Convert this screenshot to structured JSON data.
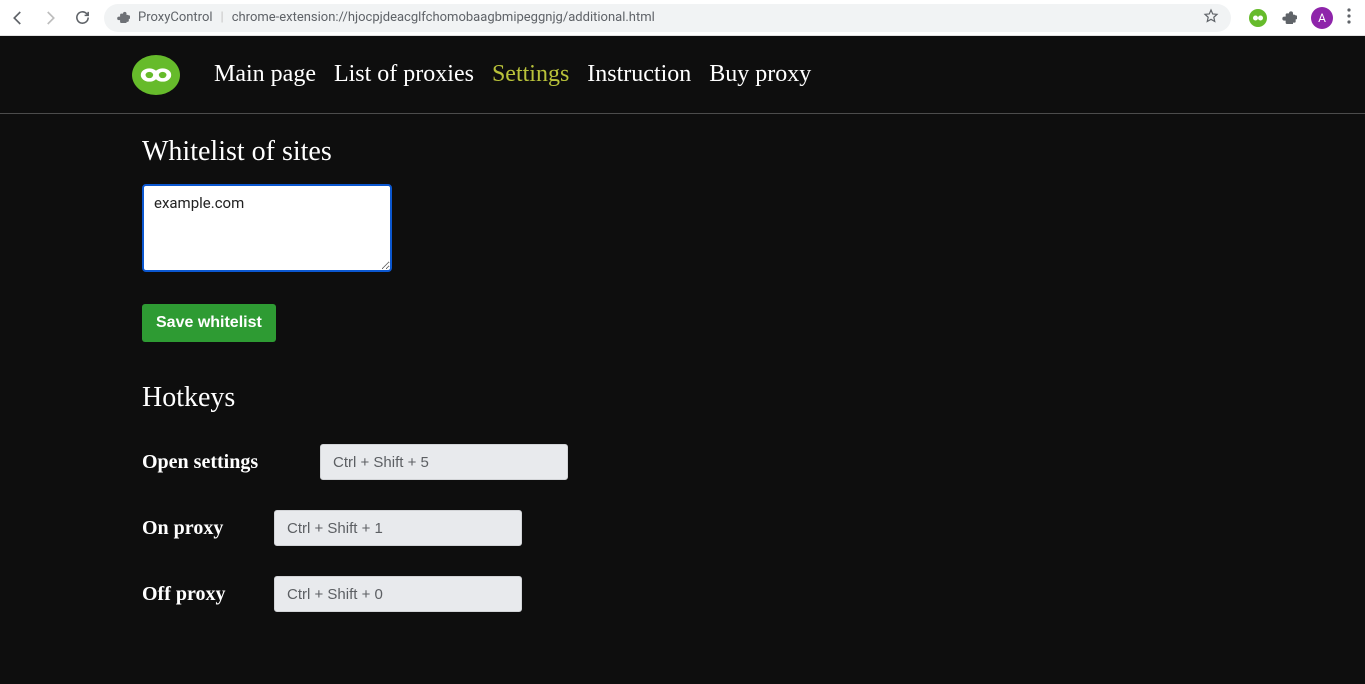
{
  "browser": {
    "page_title": "ProxyControl",
    "url": "chrome-extension://hjocpjdeacglfchomobaagbmipeggnjg/additional.html",
    "avatar_letter": "A"
  },
  "nav": {
    "items": [
      {
        "label": "Main page"
      },
      {
        "label": "List of proxies"
      },
      {
        "label": "Settings",
        "active": true
      },
      {
        "label": "Instruction"
      },
      {
        "label": "Buy proxy"
      }
    ]
  },
  "whitelist": {
    "title": "Whitelist of sites",
    "value": "example.com",
    "save_label": "Save whitelist"
  },
  "hotkeys": {
    "title": "Hotkeys",
    "rows": [
      {
        "label": "Open settings",
        "value": "Ctrl + Shift + 5"
      },
      {
        "label": "On proxy",
        "value": "Ctrl + Shift + 1"
      },
      {
        "label": "Off proxy",
        "value": "Ctrl + Shift + 0"
      }
    ]
  }
}
